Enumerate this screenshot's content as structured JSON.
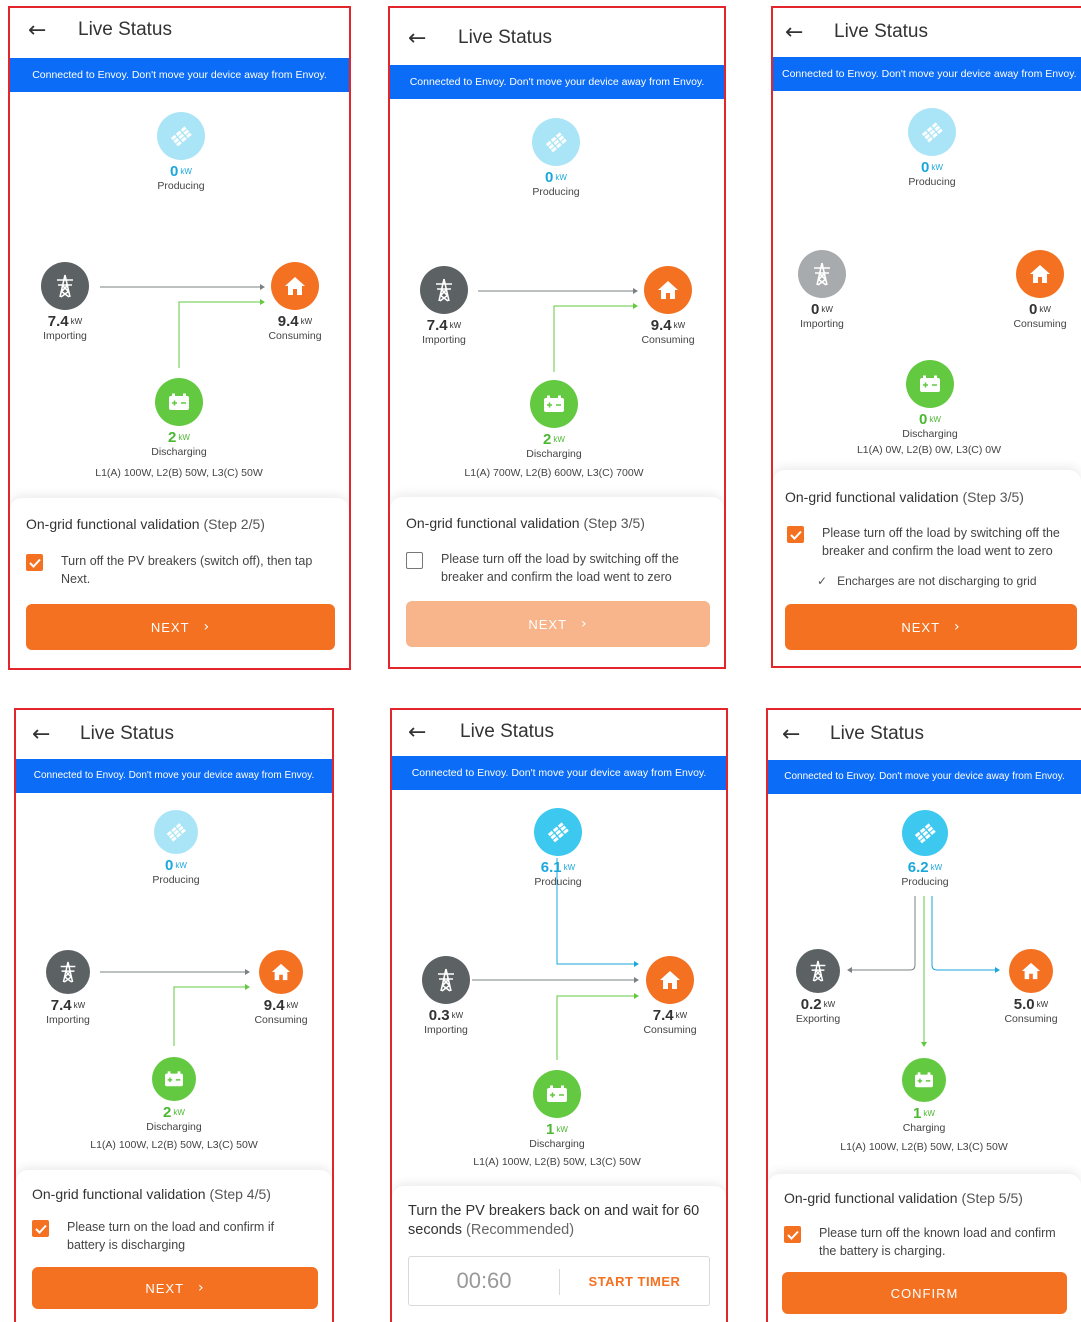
{
  "common": {
    "title": "Live Status",
    "banner": "Connected to Envoy. Don't move your device away from Envoy.",
    "unit": "kW",
    "colors": {
      "accent": "#f37121",
      "banner": "#0b6cf7",
      "frame": "#e3262b",
      "solar": "#3cc8ef",
      "grid": "#5c6164",
      "home": "#f37121",
      "battery": "#62c940"
    }
  },
  "screens": [
    {
      "producing": {
        "value": "0",
        "label": "Producing"
      },
      "grid": {
        "value": "7.4",
        "label": "Importing"
      },
      "home": {
        "value": "9.4",
        "label": "Consuming"
      },
      "battery": {
        "value": "2",
        "label": "Discharging"
      },
      "phases": "L1(A) 100W, L2(B) 50W, L3(C) 50W",
      "card": {
        "title": "On-grid functional validation",
        "step": "(Step 2/5)",
        "check_text": "Turn off the PV breakers (switch off), then tap Next.",
        "checked": true,
        "button": "NEXT"
      }
    },
    {
      "producing": {
        "value": "0",
        "label": "Producing"
      },
      "grid": {
        "value": "7.4",
        "label": "Importing"
      },
      "home": {
        "value": "9.4",
        "label": "Consuming"
      },
      "battery": {
        "value": "2",
        "label": "Discharging"
      },
      "phases": "L1(A) 700W, L2(B) 600W, L3(C) 700W",
      "card": {
        "title": "On-grid functional validation",
        "step": "(Step 3/5)",
        "check_text": "Please turn off the load by switching off the breaker and confirm the load went to zero",
        "checked": false,
        "button": "NEXT"
      }
    },
    {
      "producing": {
        "value": "0",
        "label": "Producing"
      },
      "grid": {
        "value": "0",
        "label": "Importing"
      },
      "home": {
        "value": "0",
        "label": "Consuming"
      },
      "battery": {
        "value": "0",
        "label": "Discharging"
      },
      "phases": "L1(A) 0W, L2(B) 0W, L3(C) 0W",
      "card": {
        "title": "On-grid functional validation",
        "step": "(Step 3/5)",
        "check_text": "Please turn off the load by switching off the breaker and confirm the load went to zero",
        "checked": true,
        "sub_check": "Encharges are not discharging to grid",
        "button": "NEXT"
      }
    },
    {
      "producing": {
        "value": "0",
        "label": "Producing"
      },
      "grid": {
        "value": "7.4",
        "label": "Importing"
      },
      "home": {
        "value": "9.4",
        "label": "Consuming"
      },
      "battery": {
        "value": "2",
        "label": "Discharging"
      },
      "phases": "L1(A) 100W, L2(B) 50W, L3(C) 50W",
      "card": {
        "title": "On-grid functional validation",
        "step": "(Step 4/5)",
        "check_text": "Please turn on the load and confirm if battery is discharging",
        "checked": true,
        "button": "NEXT"
      }
    },
    {
      "producing": {
        "value": "6.1",
        "label": "Producing"
      },
      "grid": {
        "value": "0.3",
        "label": "Importing"
      },
      "home": {
        "value": "7.4",
        "label": "Consuming"
      },
      "battery": {
        "value": "1",
        "label": "Discharging"
      },
      "phases": "L1(A) 100W, L2(B) 50W, L3(C) 50W",
      "card": {
        "heading": "Turn the PV breakers back on and wait for 60 seconds",
        "recommended": "(Recommended)",
        "timer": "00:60",
        "timer_button": "START TIMER"
      }
    },
    {
      "producing": {
        "value": "6.2",
        "label": "Producing"
      },
      "grid": {
        "value": "0.2",
        "label": "Exporting"
      },
      "home": {
        "value": "5.0",
        "label": "Consuming"
      },
      "battery": {
        "value": "1",
        "label": "Charging"
      },
      "phases": "L1(A) 100W, L2(B) 50W, L3(C) 50W",
      "card": {
        "title": "On-grid functional validation",
        "step": "(Step 5/5)",
        "check_text": "Please turn off the known load and confirm the battery is charging.",
        "checked": true,
        "button": "CONFIRM"
      }
    }
  ]
}
